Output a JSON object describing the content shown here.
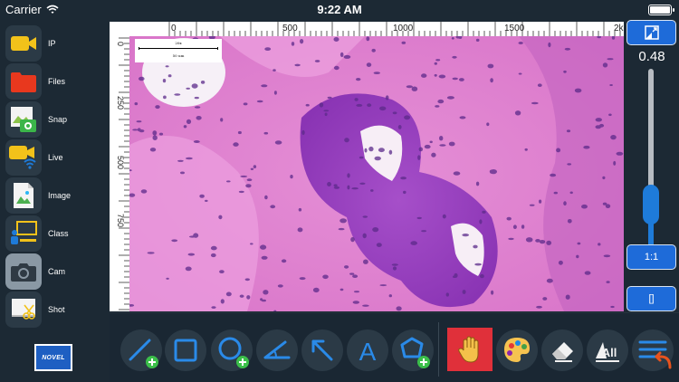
{
  "status": {
    "carrier": "Carrier",
    "time": "9:22 AM"
  },
  "sidebar": {
    "items": [
      {
        "label": "IP",
        "icon": "video-camera-icon"
      },
      {
        "label": "Files",
        "icon": "folder-icon"
      },
      {
        "label": "Snap",
        "icon": "snapshot-camera-icon"
      },
      {
        "label": "Live",
        "icon": "live-camera-icon"
      },
      {
        "label": "Image",
        "icon": "image-icon"
      },
      {
        "label": "Class",
        "icon": "classroom-icon"
      },
      {
        "label": "Cam",
        "icon": "camera-icon"
      },
      {
        "label": "Shot",
        "icon": "screenshot-icon"
      }
    ],
    "active": "Cam",
    "logo": "NOVEL"
  },
  "viewer": {
    "ruler_top_labels": [
      "0",
      "500",
      "1000",
      "1500",
      "2k"
    ],
    "ruler_left_labels": [
      "0",
      "250",
      "500",
      "750"
    ],
    "scalebar_top": "20x",
    "scalebar_bottom": "50 um"
  },
  "zoom": {
    "value": "0.48",
    "level": 0.24,
    "btn_ratio": "1:1",
    "btn_fit": "[]"
  },
  "tools": [
    {
      "name": "line-tool",
      "icon": "line-add-icon"
    },
    {
      "name": "rectangle-tool",
      "icon": "rectangle-icon"
    },
    {
      "name": "circle-tool",
      "icon": "circle-add-icon"
    },
    {
      "name": "angle-tool",
      "icon": "angle-icon"
    },
    {
      "name": "arrow-tool",
      "icon": "arrow-icon"
    },
    {
      "name": "text-tool",
      "icon": "text-a-icon",
      "glyph": "A"
    },
    {
      "name": "polygon-tool",
      "icon": "polygon-add-icon"
    },
    {
      "name": "pan-tool",
      "icon": "hand-icon"
    },
    {
      "name": "color-tool",
      "icon": "palette-icon"
    },
    {
      "name": "eraser-tool",
      "icon": "eraser-icon"
    },
    {
      "name": "clear-all-tool",
      "icon": "clear-all-icon",
      "glyph": "All"
    },
    {
      "name": "menu-undo-tool",
      "icon": "menu-undo-icon"
    }
  ],
  "colors": {
    "accent": "#1e6bd9",
    "active_tool": "#e0303a",
    "background": "#1c2934"
  }
}
